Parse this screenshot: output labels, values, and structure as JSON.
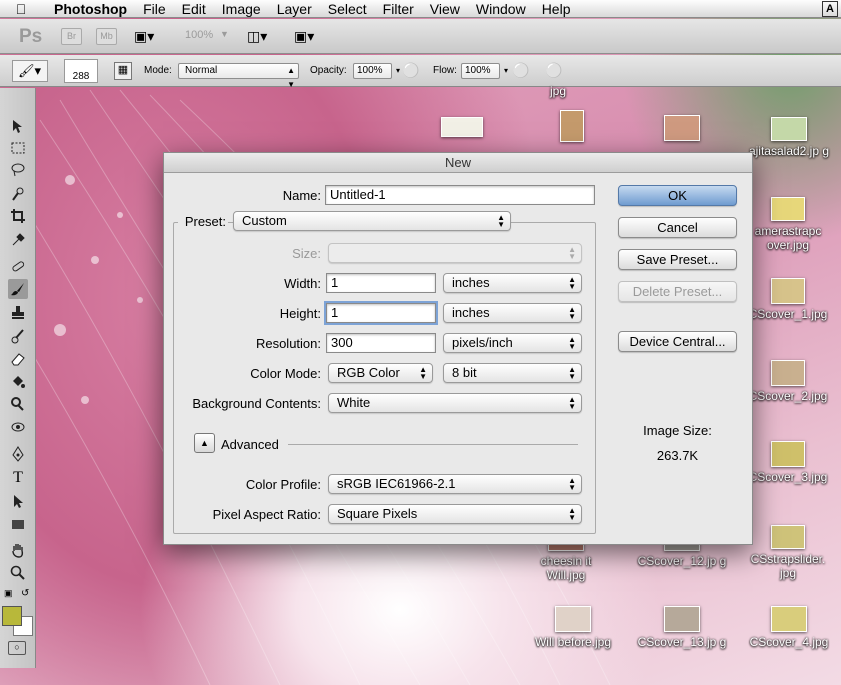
{
  "menubar": {
    "app": "Photoshop",
    "items": [
      "File",
      "Edit",
      "Image",
      "Layer",
      "Select",
      "Filter",
      "View",
      "Window",
      "Help"
    ]
  },
  "appbar": {
    "logo": "Ps",
    "bridge": "Br",
    "minibridge": "Mb",
    "zoom": "100%"
  },
  "options": {
    "brush_size": "288",
    "mode_label": "Mode:",
    "mode_value": "Normal",
    "opacity_label": "Opacity:",
    "opacity_value": "100%",
    "flow_label": "Flow:",
    "flow_value": "100%"
  },
  "desktop": {
    "icons": [
      {
        "label": "jpg",
        "color": "#d9c9a0"
      },
      {
        "label": "",
        "color": "#f2f0e6"
      },
      {
        "label": "",
        "color": "#c49a6c"
      },
      {
        "label": "",
        "color": "#cf9a80"
      },
      {
        "label": "ajitasalad2.jp g",
        "color": "#c4d8a8"
      },
      {
        "label": "amerastrapc over.jpg",
        "color": "#e7d77a"
      },
      {
        "label": "CScover_1.jpg",
        "color": "#d7c38b"
      },
      {
        "label": "CScover_2.jpg",
        "color": "#c9b08f"
      },
      {
        "label": "CScover_3.jpg",
        "color": "#cfc06a"
      },
      {
        "label": "cheesin it Will.jpg",
        "color": "#b77a6e"
      },
      {
        "label": "CScover_12.jp g",
        "color": "#a7a29c"
      },
      {
        "label": "CSstrapslider. jpg",
        "color": "#cfc37a"
      },
      {
        "label": "Will before.jpg",
        "color": "#e0d2c8"
      },
      {
        "label": "CScover_13.jp g",
        "color": "#b6a99a"
      },
      {
        "label": "CScover_4.jpg",
        "color": "#d9cd7c"
      }
    ]
  },
  "dialog": {
    "title": "New",
    "name_label": "Name:",
    "name_value": "Untitled-1",
    "preset_label": "Preset:",
    "preset_value": "Custom",
    "size_label": "Size:",
    "size_value": "",
    "width_label": "Width:",
    "width_value": "1",
    "width_unit": "inches",
    "height_label": "Height:",
    "height_value": "1",
    "height_unit": "inches",
    "resolution_label": "Resolution:",
    "resolution_value": "300",
    "resolution_unit": "pixels/inch",
    "colormode_label": "Color Mode:",
    "colormode_value": "RGB Color",
    "bitdepth_value": "8 bit",
    "background_label": "Background Contents:",
    "background_value": "White",
    "advanced_label": "Advanced",
    "profile_label": "Color Profile:",
    "profile_value": "sRGB IEC61966-2.1",
    "aspect_label": "Pixel Aspect Ratio:",
    "aspect_value": "Square Pixels",
    "ok": "OK",
    "cancel": "Cancel",
    "save_preset": "Save Preset...",
    "delete_preset": "Delete Preset...",
    "device_central": "Device Central...",
    "image_size_label": "Image Size:",
    "image_size_value": "263.7K"
  },
  "colors": {
    "foreground": "#b8b83a",
    "background": "#ffffff"
  }
}
